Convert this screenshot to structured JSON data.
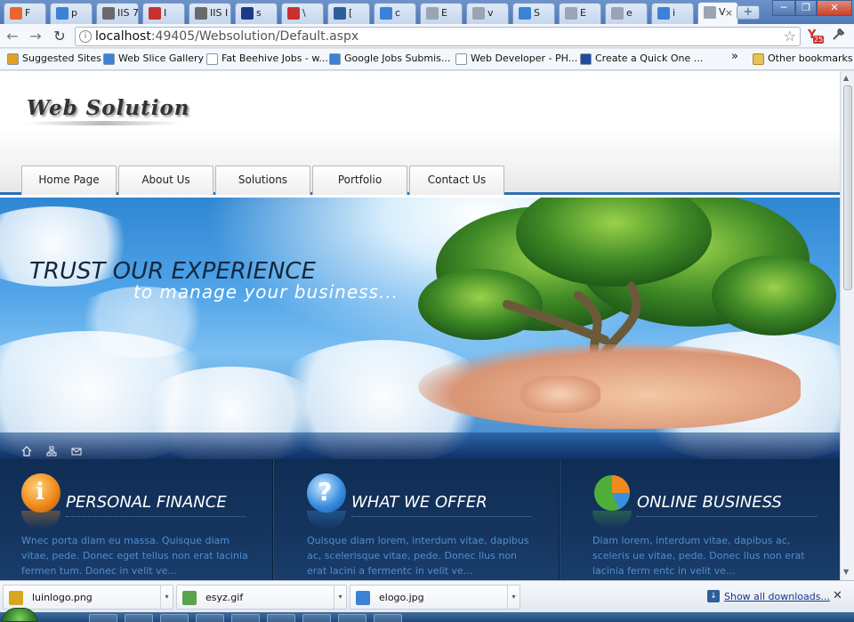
{
  "browser": {
    "tabs": [
      {
        "label": "F",
        "icon": "firefox-icon",
        "color": "#e8662a"
      },
      {
        "label": "p",
        "icon": "google-icon",
        "color": "#3b82d6"
      },
      {
        "label": "IIS 7",
        "icon": "iis-icon",
        "color": "#6a6a6a"
      },
      {
        "label": "I",
        "icon": "book-icon",
        "color": "#c8312f"
      },
      {
        "label": "IIS I",
        "icon": "iis-icon",
        "color": "#6a6a6a"
      },
      {
        "label": "s",
        "icon": "info-icon",
        "color": "#1a3a8a"
      },
      {
        "label": "\\",
        "icon": "book-icon",
        "color": "#c8312f"
      },
      {
        "label": "[",
        "icon": "download-icon",
        "color": "#2d5e9a"
      },
      {
        "label": "c",
        "icon": "google-icon",
        "color": "#3b82d6"
      },
      {
        "label": "E",
        "icon": "page-icon",
        "color": "#9aa4b2"
      },
      {
        "label": "v",
        "icon": "page-icon",
        "color": "#9aa4b2"
      },
      {
        "label": "S",
        "icon": "globe-icon",
        "color": "#3b82d6"
      },
      {
        "label": "E",
        "icon": "page-icon",
        "color": "#9aa4b2"
      },
      {
        "label": "e",
        "icon": "page-icon",
        "color": "#9aa4b2"
      },
      {
        "label": "i",
        "icon": "google-icon",
        "color": "#3b82d6"
      },
      {
        "label": "V",
        "icon": "page-icon",
        "color": "#9aa4b2",
        "close": "×"
      }
    ],
    "new_tab_label": "+",
    "window_controls": {
      "minimize": "─",
      "restore": "❐",
      "close": "✕"
    },
    "nav": {
      "back": "←",
      "forward": "→",
      "reload": "↻"
    },
    "address": {
      "host": "localhost",
      "rest": ":49405/Websolution/Default.aspx"
    },
    "star": "☆",
    "extension_badge": "25",
    "wrench": "🔧",
    "bookmarks": [
      {
        "label": "Suggested Sites",
        "icon": "suggested-sites-icon",
        "color": "#e0a020"
      },
      {
        "label": "Web Slice Gallery",
        "icon": "ie-icon",
        "color": "#3b82d6"
      },
      {
        "label": "Fat Beehive Jobs - w...",
        "icon": "page-icon",
        "color": "#ffffff"
      },
      {
        "label": "Google Jobs Submis...",
        "icon": "google-icon",
        "color": "#3b82d6"
      },
      {
        "label": "Web Developer - PH...",
        "icon": "page-icon",
        "color": "#ffffff"
      },
      {
        "label": "Create a Quick One ...",
        "icon": "plus-icon",
        "color": "#1f4aa0"
      }
    ],
    "bookmarks_overflow": "»",
    "other_bookmarks": "Other bookmarks"
  },
  "site": {
    "logo": "Web Solution",
    "menu": [
      "Home Page",
      "About Us",
      "Solutions",
      "Portfolio",
      "Contact Us"
    ],
    "hero": {
      "title": "TRUST OUR EXPERIENCE",
      "subtitle": "to manage your business..."
    },
    "strip_icons": [
      "home-icon",
      "sitemap-icon",
      "mail-icon"
    ],
    "features": [
      {
        "title": "PERSONAL FINANCE",
        "icon": "info-icon",
        "text": "Wnec porta diam eu massa. Quisque diam vitae, pede. Donec eget tellus non erat lacinia fermen tum. Donec in velit ve..."
      },
      {
        "title": "WHAT WE OFFER",
        "icon": "question-icon",
        "text": "Quisque diam lorem, interdum vitae, dapibus ac, scelerisque vitae, pede. Donec llus non erat lacini a fermentc in velit ve..."
      },
      {
        "title": "ONLINE BUSINESS",
        "icon": "pie-chart-icon",
        "text": "Diam lorem, interdum vitae, dapibus ac, sceleris ue vitae, pede. Donec llus non erat lacinia ferm entc in velit ve..."
      }
    ]
  },
  "downloads": {
    "items": [
      {
        "name": "luinlogo.png",
        "icon": "image-file-icon"
      },
      {
        "name": "esyz.gif",
        "icon": "image-file-icon"
      },
      {
        "name": "elogo.jpg",
        "icon": "image-file-icon"
      }
    ],
    "menu_arrow": "▾",
    "show_all": "Show all downloads...",
    "close": "✕"
  }
}
